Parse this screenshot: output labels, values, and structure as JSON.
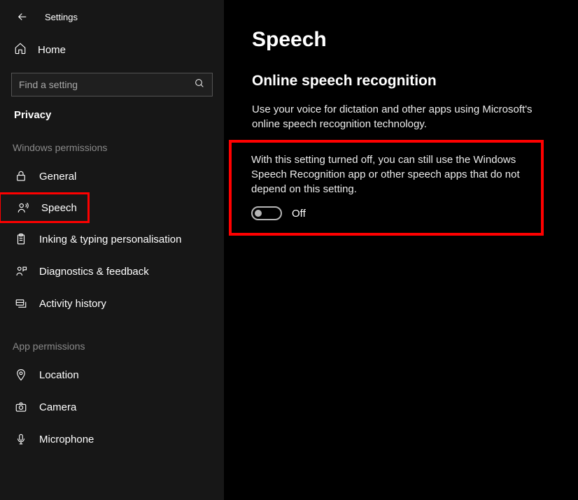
{
  "app_title": "Settings",
  "sidebar": {
    "home": "Home",
    "search_placeholder": "Find a setting",
    "privacy_label": "Privacy",
    "group_windows": "Windows permissions",
    "items_windows": [
      {
        "label": "General"
      },
      {
        "label": "Speech"
      },
      {
        "label": "Inking & typing personalisation"
      },
      {
        "label": "Diagnostics & feedback"
      },
      {
        "label": "Activity history"
      }
    ],
    "group_app": "App permissions",
    "items_app": [
      {
        "label": "Location"
      },
      {
        "label": "Camera"
      },
      {
        "label": "Microphone"
      }
    ]
  },
  "page": {
    "title": "Speech",
    "section_title": "Online speech recognition",
    "desc": "Use your voice for dictation and other apps using Microsoft's online speech recognition technology.",
    "off_desc": "With this setting turned off, you can still use the Windows Speech Recognition app or other speech apps that do not depend on this setting.",
    "toggle_state": "Off"
  }
}
